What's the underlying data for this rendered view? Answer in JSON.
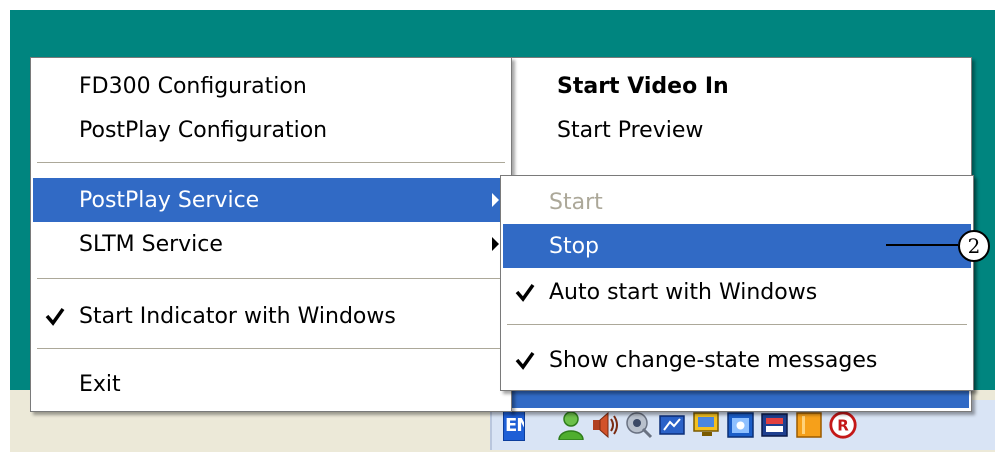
{
  "main_menu": {
    "items": [
      {
        "label": "FD300 Configuration"
      },
      {
        "label": "PostPlay Configuration"
      },
      {
        "label": "PostPlay Service"
      },
      {
        "label": "SLTM Service"
      },
      {
        "label": "Start Indicator with Windows",
        "checked": true
      },
      {
        "label": "Exit"
      }
    ]
  },
  "background_menu": {
    "items": [
      {
        "label": "Start Video In",
        "bold": true
      },
      {
        "label": "Start Preview"
      }
    ]
  },
  "service_submenu": {
    "items": [
      {
        "label": "Start",
        "disabled": true
      },
      {
        "label": "Stop",
        "highlighted": true
      },
      {
        "label": "Auto start with Windows",
        "checked": true
      },
      {
        "label": "Show change-state messages",
        "checked": true
      }
    ]
  },
  "callout": {
    "number": "2"
  },
  "taskbar": {
    "language": "EN",
    "tray_icons": [
      "user-icon",
      "speaker-icon",
      "network-icon",
      "display-icon",
      "monitor-icon",
      "window-icon",
      "app-icon",
      "folder-icon",
      "registered-icon"
    ]
  },
  "colors": {
    "desktop": "#00857f",
    "highlight": "#316ac5",
    "taskbar": "#ece9d8",
    "tray": "#d9e4f5"
  }
}
